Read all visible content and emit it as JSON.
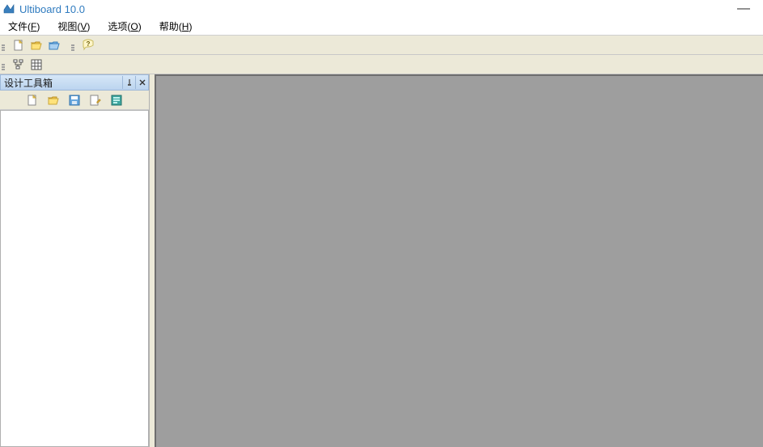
{
  "title": "Ultiboard 10.0",
  "menubar": {
    "file": {
      "label": "文件",
      "hotkey": "F"
    },
    "view": {
      "label": "视图",
      "hotkey": "V"
    },
    "options": {
      "label": "选项",
      "hotkey": "O"
    },
    "help": {
      "label": "帮助",
      "hotkey": "H"
    }
  },
  "toolbar1": {
    "new": "new-file-icon",
    "open": "open-file-icon",
    "opendb": "open-db-icon",
    "help": "help-icon"
  },
  "toolbar2": {
    "tree": "tree-view-icon",
    "grid": "grid-view-icon"
  },
  "panel": {
    "title": "设计工具箱",
    "pin": "pin-icon",
    "close": "close-icon",
    "tools": {
      "new": "new-file-icon",
      "open": "open-file-icon",
      "save": "save-icon",
      "rename": "rename-icon",
      "properties": "properties-icon"
    }
  },
  "window_controls": {
    "minimize": "—"
  }
}
